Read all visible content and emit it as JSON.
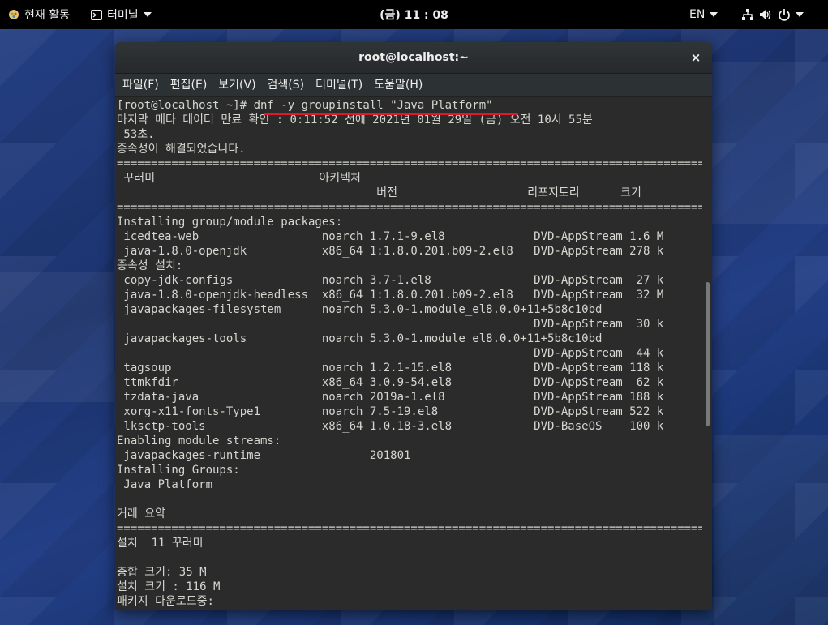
{
  "topbar": {
    "activities_label": "현재 활동",
    "app_menu_label": "터미널",
    "clock": "(금) 11 : 08",
    "language": "EN"
  },
  "window": {
    "title": "root@localhost:~",
    "close_glyph": "×",
    "menu": [
      "파일(F)",
      "편집(E)",
      "보기(V)",
      "검색(S)",
      "터미널(T)",
      "도움말(H)"
    ]
  },
  "terminal": {
    "lines": [
      "[root@localhost ~]# dnf -y groupinstall \"Java Platform\"",
      "마지막 메타 데이터 만료 확인 : 0:11:52 전에 2021년 01월 29일 (금) 오전 10시 55분",
      " 53초.",
      "종속성이 해결되었습니다.",
      "=========================================================================================",
      " 꾸러미                        아키텍처",
      "                                      버전                   리포지토리      크기",
      "=========================================================================================",
      "Installing group/module packages:",
      " icedtea-web                  noarch 1.7.1-9.el8             DVD-AppStream 1.6 M",
      " java-1.8.0-openjdk           x86_64 1:1.8.0.201.b09-2.el8   DVD-AppStream 278 k",
      "종속성 설치:",
      " copy-jdk-configs             noarch 3.7-1.el8               DVD-AppStream  27 k",
      " java-1.8.0-openjdk-headless  x86_64 1:1.8.0.201.b09-2.el8   DVD-AppStream  32 M",
      " javapackages-filesystem      noarch 5.3.0-1.module_el8.0.0+11+5b8c10bd",
      "                                                             DVD-AppStream  30 k",
      " javapackages-tools           noarch 5.3.0-1.module_el8.0.0+11+5b8c10bd",
      "                                                             DVD-AppStream  44 k",
      " tagsoup                      noarch 1.2.1-15.el8            DVD-AppStream 118 k",
      " ttmkfdir                     x86_64 3.0.9-54.el8            DVD-AppStream  62 k",
      " tzdata-java                  noarch 2019a-1.el8             DVD-AppStream 188 k",
      " xorg-x11-fonts-Type1         noarch 7.5-19.el8              DVD-AppStream 522 k",
      " lksctp-tools                 x86_64 1.0.18-3.el8            DVD-BaseOS    100 k",
      "Enabling module streams:",
      " javapackages-runtime                201801",
      "Installing Groups:",
      " Java Platform",
      "",
      "거래 요약",
      "=========================================================================================",
      "설치  11 꾸러미",
      "",
      "총합 크기: 35 M",
      "설치 크기 : 116 M",
      "패키지 다운로드중:"
    ]
  }
}
